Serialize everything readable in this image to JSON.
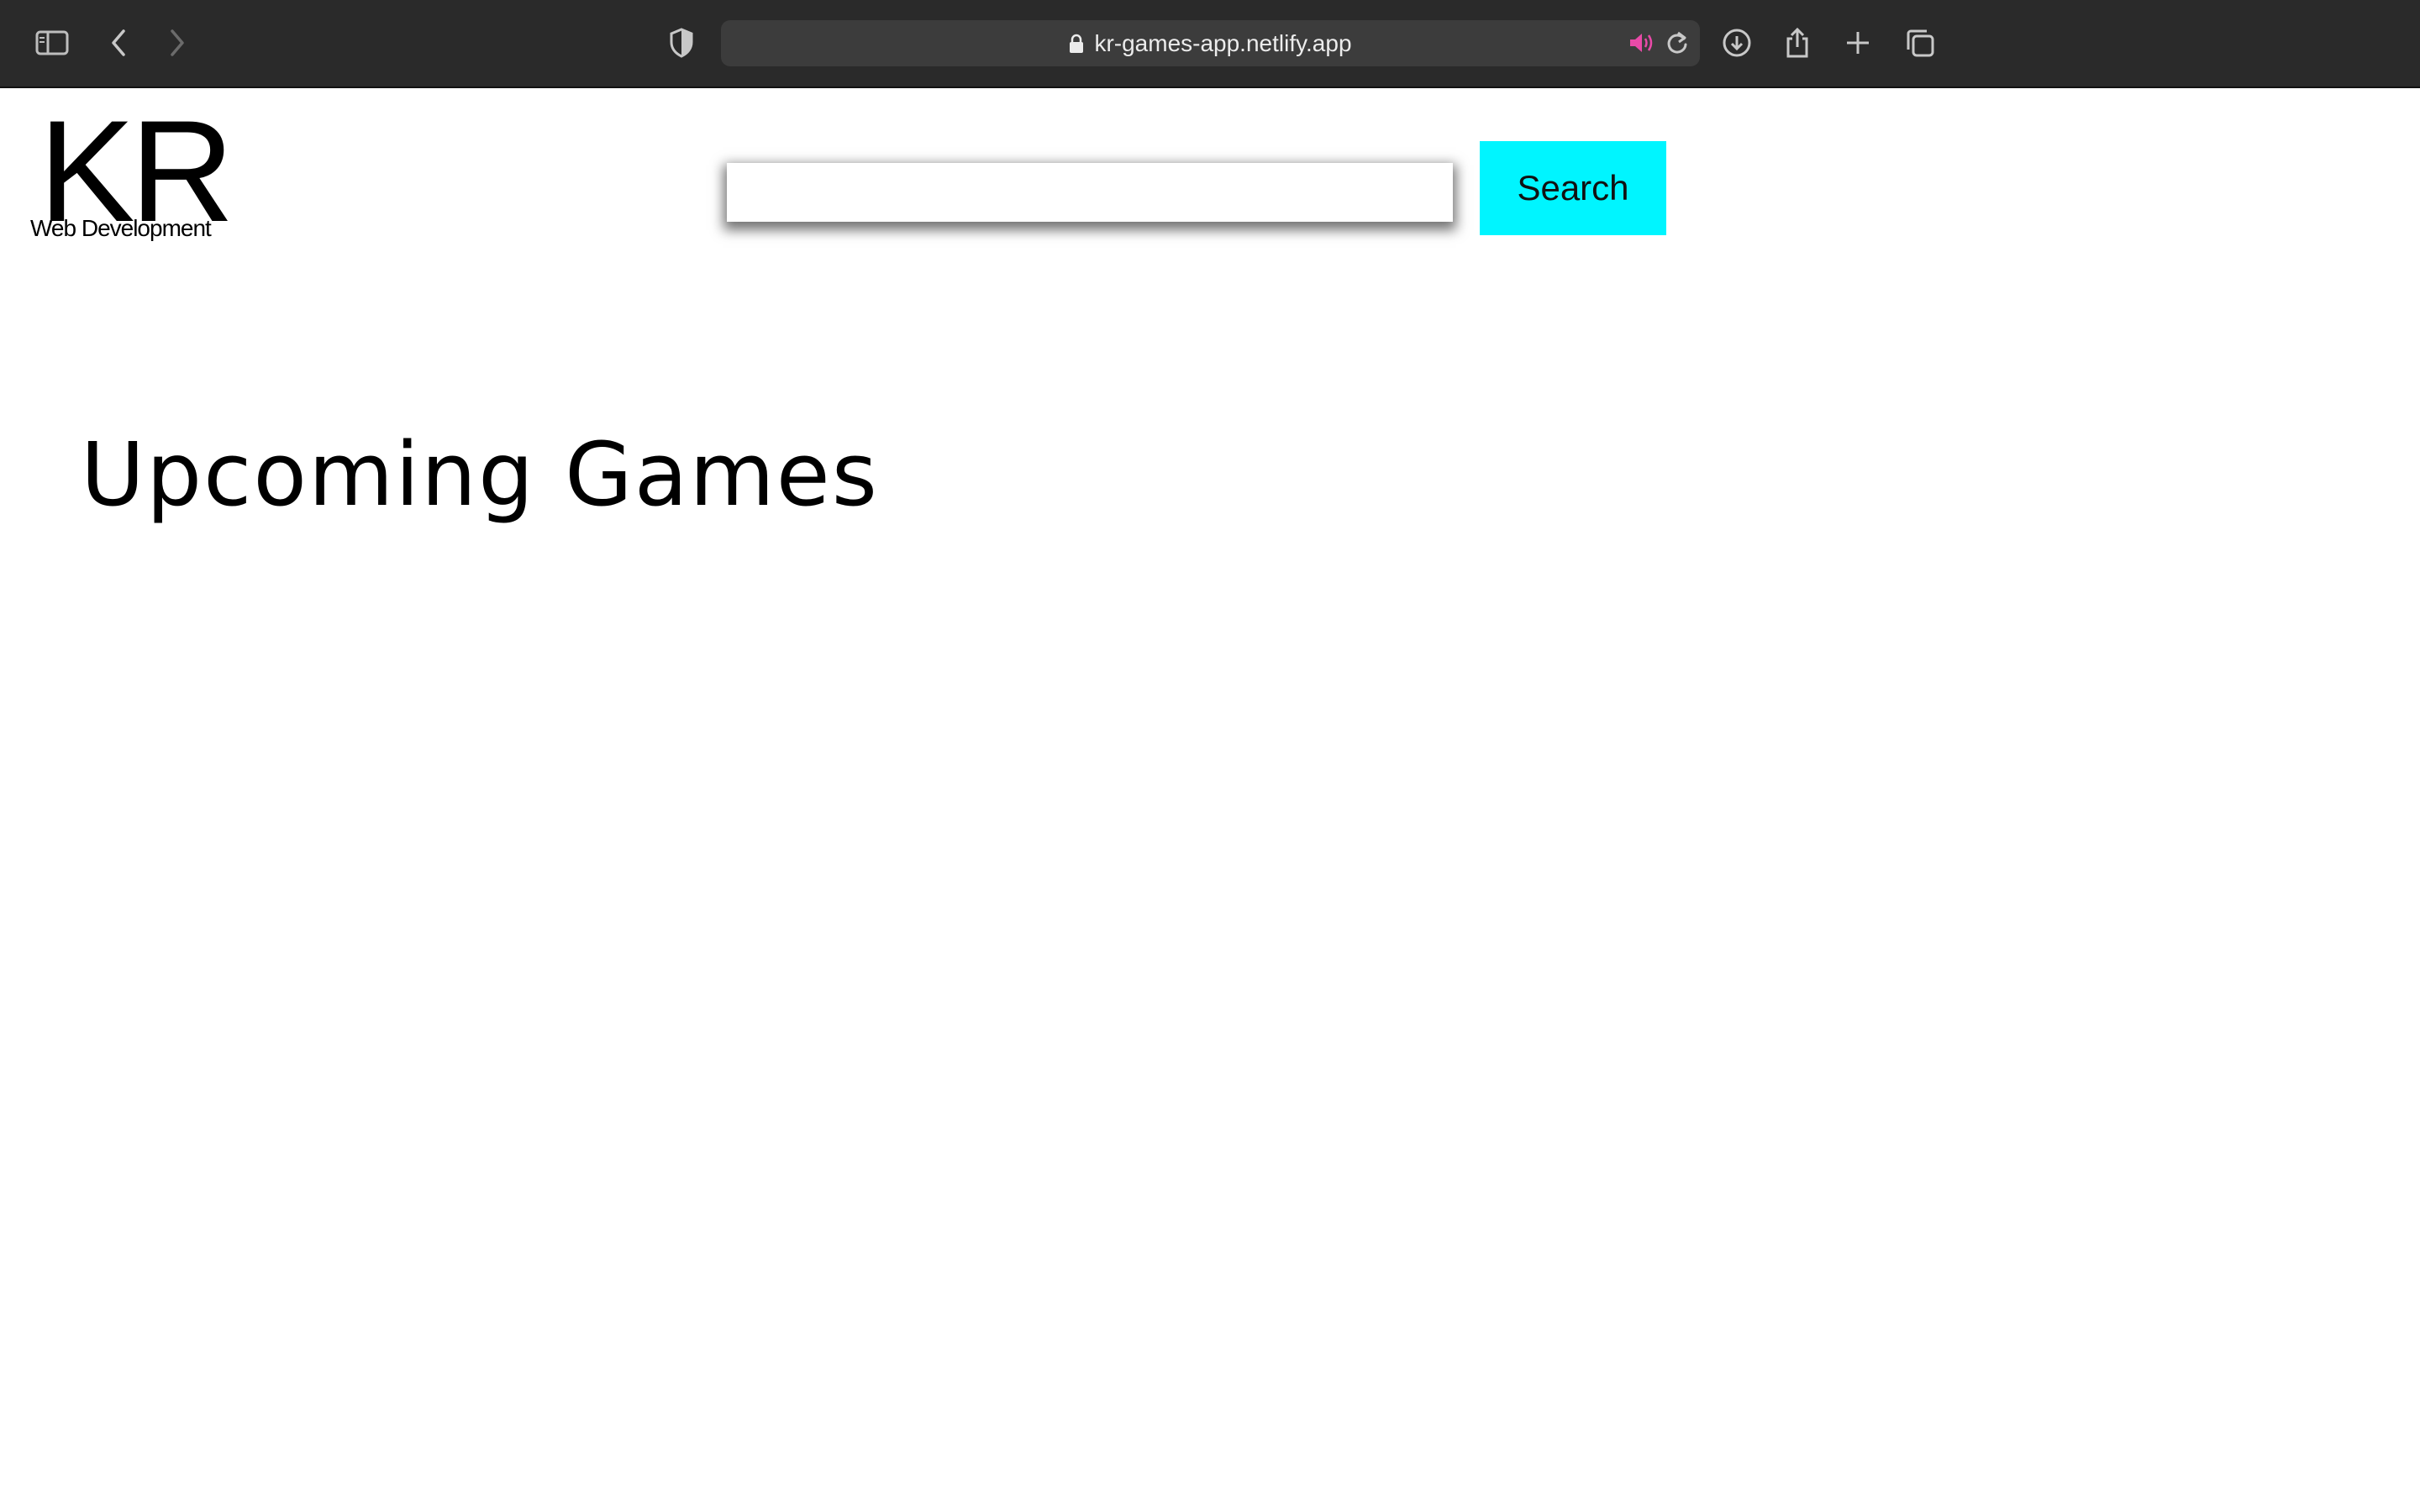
{
  "browser": {
    "url": "kr-games-app.netlify.app",
    "colors": {
      "toolbar_bg": "#2a2a2a",
      "urlbar_bg": "#3c3c3c",
      "audio_icon": "#e94aa8"
    },
    "icons": [
      "sidebar-icon",
      "back-icon",
      "forward-icon",
      "shield-icon",
      "lock-icon",
      "speaker-icon",
      "reload-icon",
      "download-icon",
      "share-icon",
      "new-tab-icon",
      "tabs-overview-icon"
    ]
  },
  "header": {
    "logo_mark": "KR",
    "logo_subtitle": "Web Development",
    "search_placeholder": "",
    "search_button_label": "Search",
    "colors": {
      "search_button_bg": "#00f5ff"
    }
  },
  "main": {
    "heading": "Upcoming Games"
  }
}
